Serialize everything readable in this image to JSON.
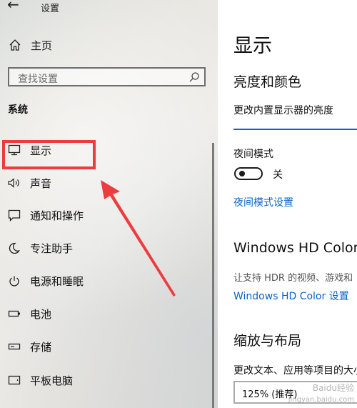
{
  "titlebar": {
    "back_icon": "back-arrow-icon",
    "title": "设置"
  },
  "sidebar": {
    "home_label": "主页",
    "search_placeholder": "查找设置",
    "section_title": "系统",
    "items": [
      {
        "label": "显示",
        "icon": "monitor-icon"
      },
      {
        "label": "声音",
        "icon": "speaker-icon"
      },
      {
        "label": "通知和操作",
        "icon": "notification-icon"
      },
      {
        "label": "专注助手",
        "icon": "moon-icon"
      },
      {
        "label": "电源和睡眠",
        "icon": "power-icon"
      },
      {
        "label": "电池",
        "icon": "battery-icon"
      },
      {
        "label": "存储",
        "icon": "storage-icon"
      },
      {
        "label": "平板电脑",
        "icon": "tablet-icon"
      }
    ]
  },
  "content": {
    "title": "显示",
    "brightness_heading": "亮度和颜色",
    "brightness_text": "更改内置显示器的亮度",
    "night_mode_label": "夜间模式",
    "night_mode_state": "关",
    "night_mode_link": "夜间模式设置",
    "hdr_heading": "Windows HD Color",
    "hdr_text": "让支持 HDR 的视频、游戏和",
    "hdr_link": "Windows HD Color 设置",
    "scale_heading": "缩放与布局",
    "scale_text": "更改文本、应用等项目的大小",
    "scale_value": "125% (推荐)"
  },
  "watermark": {
    "line1": "Baidu经验",
    "line2": "jingyan.baidu.com"
  },
  "colors": {
    "accent": "#0a64c8",
    "annotation_red": "#ec3c3f"
  }
}
